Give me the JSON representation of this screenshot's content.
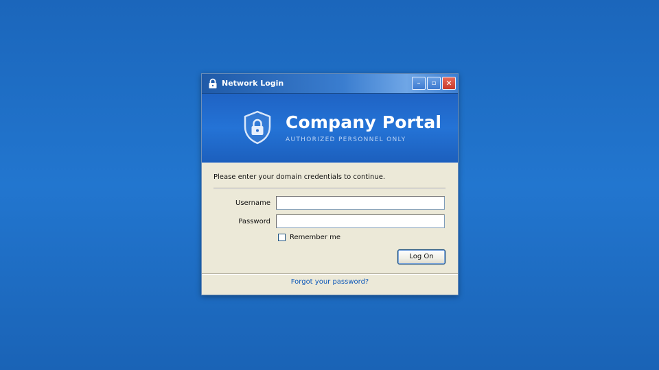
{
  "window": {
    "title": "Network Login",
    "controls": {
      "minimize": "–",
      "maximize": "▫",
      "close": "✕"
    }
  },
  "banner": {
    "title": "Company Portal",
    "subtitle": "AUTHORIZED PERSONNEL ONLY",
    "icon": "shield-lock-icon"
  },
  "form": {
    "instruction": "Please enter your domain credentials to continue.",
    "username_label": "Username",
    "username_value": "",
    "password_label": "Password",
    "password_value": "",
    "remember_label": "Remember me",
    "remember_checked": false,
    "submit_label": "Log On"
  },
  "footer": {
    "forgot_link": "Forgot your password?"
  },
  "colors": {
    "desktop": "#1f6ec6",
    "banner": "#2270d3",
    "dialog": "#ece9d8",
    "link": "#0a56b8"
  }
}
